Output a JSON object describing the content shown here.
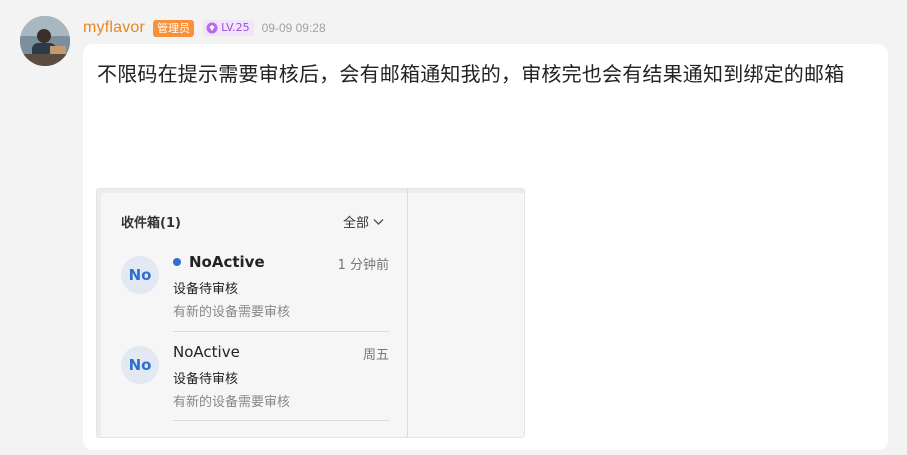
{
  "post": {
    "username": "myflavor",
    "role_badge": "管理员",
    "level_badge": "LV.25",
    "timestamp": "09-09 09:28",
    "message": "不限码在提示需要审核后，会有邮箱通知我的，审核完也会有结果通知到绑定的邮箱"
  },
  "screenshot": {
    "inbox_title": "收件箱(1)",
    "filter_label": "全部",
    "mails": [
      {
        "avatar_text": "No",
        "sender": "NoActive",
        "unread": true,
        "time": "1 分钟前",
        "subject": "设备待审核",
        "preview": "有新的设备需要审核"
      },
      {
        "avatar_text": "No",
        "sender": "NoActive",
        "unread": false,
        "time": "周五",
        "subject": "设备待审核",
        "preview": "有新的设备需要审核"
      }
    ]
  },
  "colors": {
    "username": "#e8871e",
    "role_badge_bg": "#f7913b",
    "level_badge_text": "#9b4fd6",
    "unread_dot": "#2f6fcf"
  },
  "icons": {
    "avatar": "user-avatar-photo",
    "level": "gem-icon",
    "filter": "chevron-down-icon",
    "unread": "unread-dot-icon"
  }
}
